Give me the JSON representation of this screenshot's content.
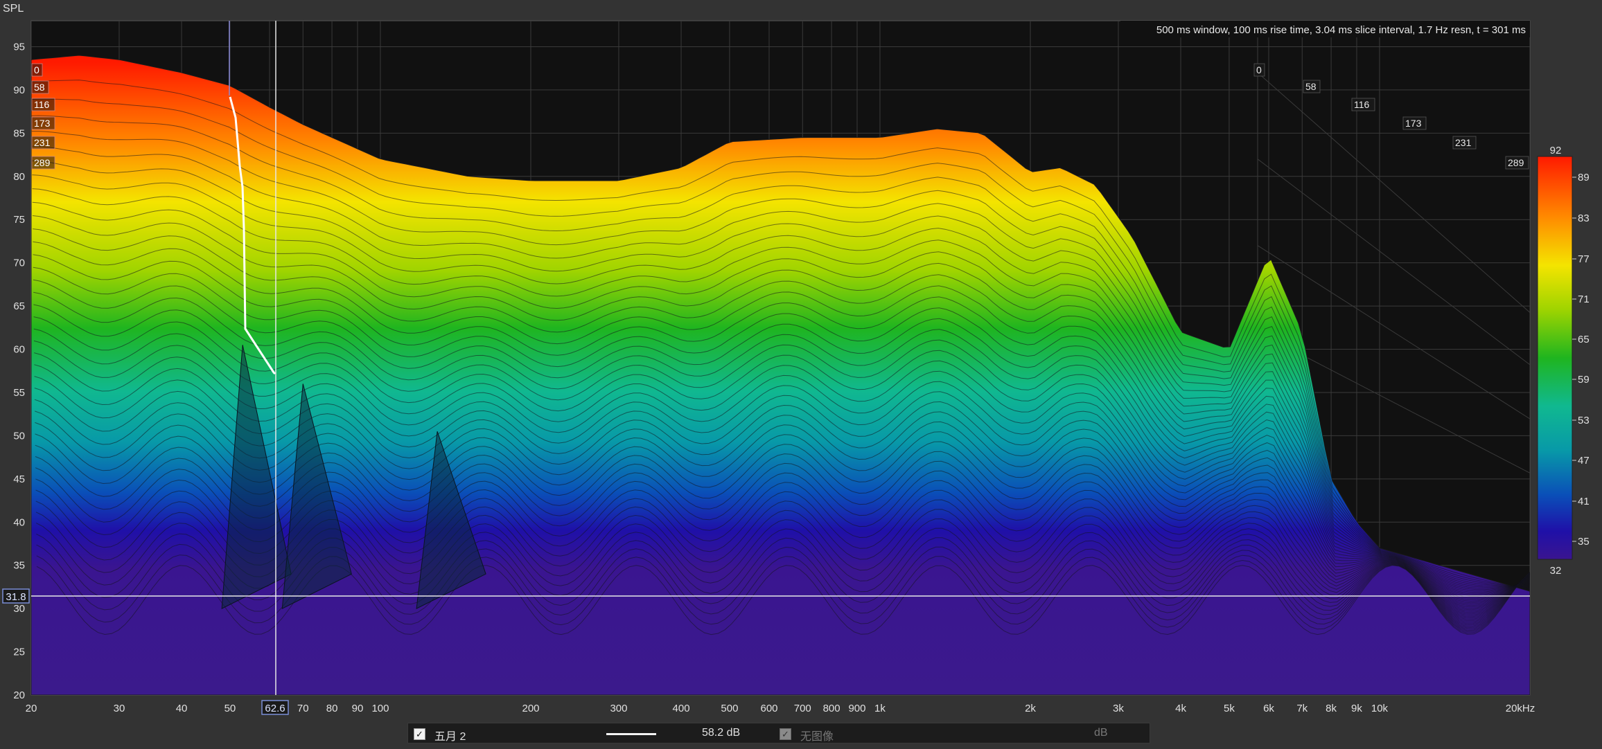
{
  "header": {
    "y_axis_title": "SPL"
  },
  "chart_data": {
    "type": "area",
    "subtype": "waterfall",
    "info": "500 ms window, 100 ms rise time, 3.04 ms slice interval, 1.7 Hz resn, t = 301 ms",
    "x_scale": "log",
    "xlim": [
      20,
      20000
    ],
    "ylim": [
      20,
      98
    ],
    "x_ticks": [
      20,
      30,
      40,
      50,
      70,
      80,
      90,
      100,
      200,
      300,
      400,
      500,
      600,
      700,
      800,
      900,
      1000,
      2000,
      3000,
      4000,
      5000,
      6000,
      7000,
      8000,
      9000,
      10000,
      20000
    ],
    "x_tick_labels": [
      "20",
      "30",
      "40",
      "50",
      "70",
      "80",
      "90",
      "100",
      "200",
      "300",
      "400",
      "500",
      "600",
      "700",
      "800",
      "900",
      "1k",
      "2k",
      "3k",
      "4k",
      "5k",
      "6k",
      "7k",
      "8k",
      "9k",
      "10k",
      "20kHz"
    ],
    "y_ticks": [
      20,
      25,
      30,
      35,
      40,
      45,
      50,
      55,
      60,
      65,
      70,
      75,
      80,
      85,
      90,
      95
    ],
    "time_ticks_ms": [
      "0",
      "58",
      "116",
      "173",
      "231",
      "289"
    ],
    "colorbar": {
      "title": "92",
      "min_label": "32",
      "labels": [
        "89",
        "83",
        "77",
        "71",
        "65",
        "59",
        "53",
        "47",
        "41",
        "35"
      ]
    },
    "cursor": {
      "x_label": "62.6",
      "y_label": "31.8"
    },
    "front_response": {
      "x": [
        20,
        25,
        30,
        40,
        50,
        60,
        70,
        100,
        150,
        200,
        300,
        400,
        500,
        700,
        1000,
        1300,
        1600,
        2000,
        2300,
        2700,
        3200,
        4000,
        5000,
        6000,
        7000,
        8000,
        9000,
        10000,
        20000
      ],
      "y": [
        93.5,
        94.0,
        93.5,
        92.0,
        90.5,
        88.0,
        86.0,
        82.0,
        80.0,
        79.5,
        79.5,
        81.0,
        84.0,
        84.5,
        84.5,
        85.5,
        85.0,
        80.5,
        81.0,
        79.0,
        73.0,
        62.0,
        60.0,
        71.0,
        62.0,
        45.0,
        40.0,
        37.0,
        32.0
      ]
    },
    "floor_db": 20
  },
  "legend": {
    "trace_name": "五月 2",
    "trace_value": "58.2 dB",
    "ref_label": "无图像",
    "ref_unit": "dB"
  }
}
